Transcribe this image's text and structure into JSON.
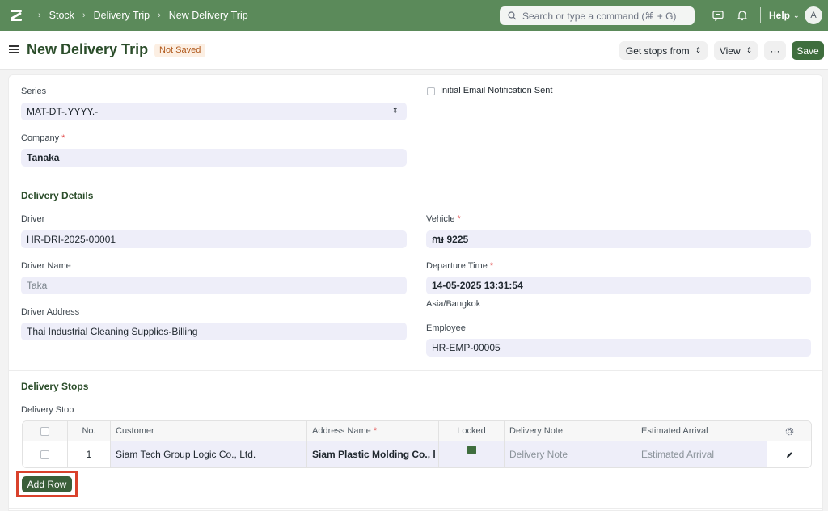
{
  "navbar": {
    "breadcrumbs": [
      "Stock",
      "Delivery Trip",
      "New Delivery Trip"
    ],
    "search_placeholder": "Search or type a command (⌘ + G)",
    "help_label": "Help",
    "avatar_initial": "A",
    "accent_color": "#5b8a5a"
  },
  "page": {
    "title": "New Delivery Trip",
    "status_badge": "Not Saved",
    "get_stops_label": "Get stops from",
    "view_label": "View",
    "more_label": "···",
    "save_label": "Save"
  },
  "form": {
    "series_label": "Series",
    "series_value": "MAT-DT-.YYYY.-",
    "email_sent_label": "Initial Email Notification Sent",
    "company_label": "Company",
    "company_value": "Tanaka",
    "delivery_details_title": "Delivery Details",
    "driver_label": "Driver",
    "driver_value": "HR-DRI-2025-00001",
    "vehicle_label": "Vehicle",
    "vehicle_value": "กษ 9225",
    "driver_name_label": "Driver Name",
    "driver_name_value": "Taka",
    "departure_time_label": "Departure Time",
    "departure_time_value": "14-05-2025 13:31:54",
    "timezone_text": "Asia/Bangkok",
    "driver_address_label": "Driver Address",
    "driver_address_value": "Thai Industrial Cleaning Supplies-Billing",
    "employee_label": "Employee",
    "employee_value": "HR-EMP-00005",
    "delivery_stops_title": "Delivery Stops",
    "delivery_stop_label": "Delivery Stop",
    "required_mark": "*"
  },
  "stops_table": {
    "headers": {
      "no": "No.",
      "customer": "Customer",
      "address_name": "Address Name",
      "locked": "Locked",
      "delivery_note": "Delivery Note",
      "estimated_arrival": "Estimated Arrival"
    },
    "rows": [
      {
        "no": "1",
        "customer": "Siam Tech Group Logic Co., Ltd.",
        "address_name": "Siam Plastic Molding Co., l",
        "delivery_note": "Delivery Note",
        "estimated_arrival": "Estimated Arrival"
      }
    ],
    "add_row_label": "Add Row"
  }
}
